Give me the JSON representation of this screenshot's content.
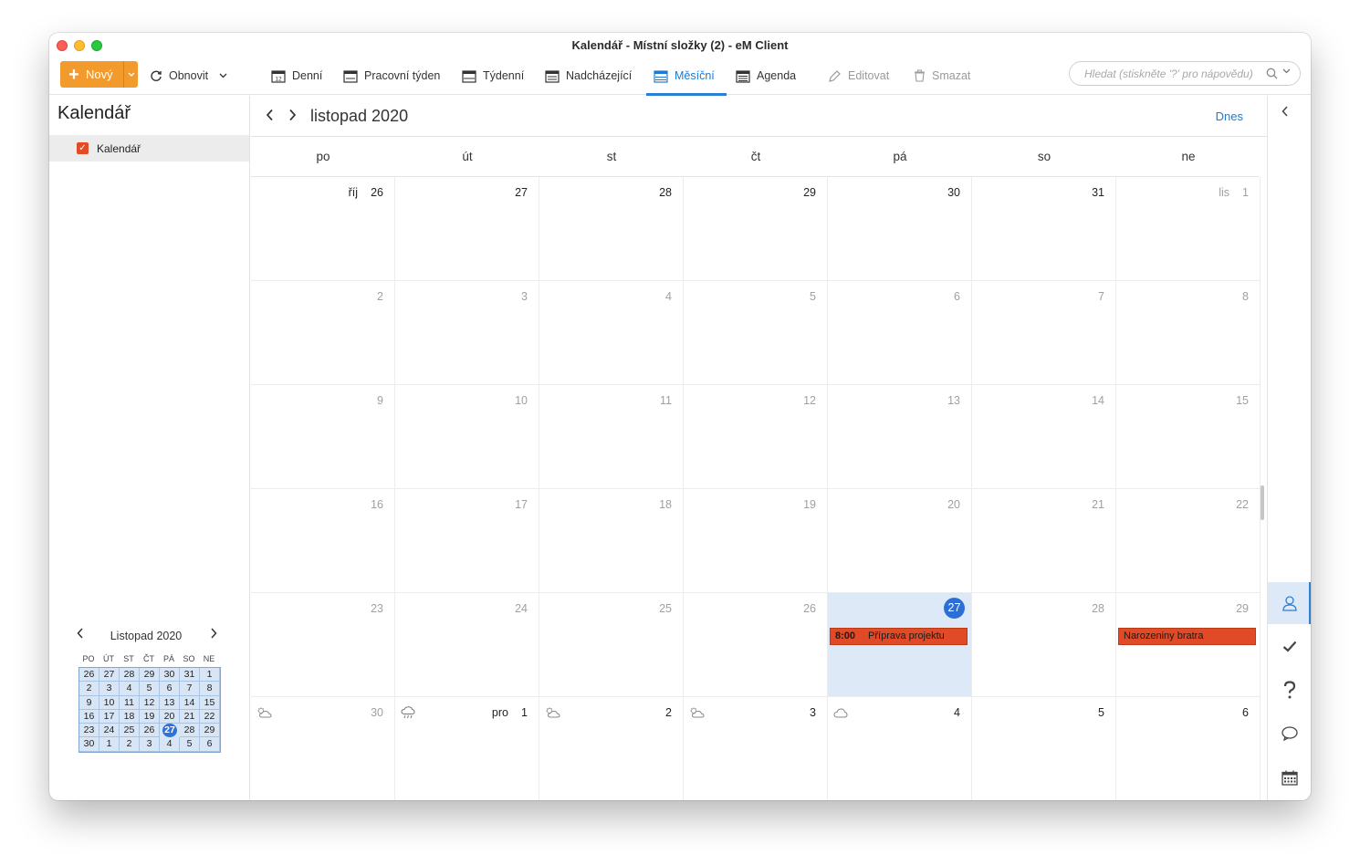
{
  "window": {
    "title": "Kalendář - Místní složky (2) - eM Client"
  },
  "toolbar": {
    "new_label": "Nový",
    "refresh_label": "Obnovit",
    "views": [
      {
        "label": "Denní",
        "icon": "calendar-day-icon"
      },
      {
        "label": "Pracovní týden",
        "icon": "calendar-workweek-icon"
      },
      {
        "label": "Týdenní",
        "icon": "calendar-week-icon"
      },
      {
        "label": "Nadcházející",
        "icon": "calendar-upcoming-icon"
      },
      {
        "label": "Měsíční",
        "icon": "calendar-month-icon",
        "active": true
      },
      {
        "label": "Agenda",
        "icon": "agenda-icon"
      }
    ],
    "edit_label": "Editovat",
    "delete_label": "Smazat",
    "search_placeholder": "Hledat (stiskněte '?' pro nápovědu)"
  },
  "sidebar": {
    "title": "Kalendář",
    "calendars": [
      {
        "label": "Kalendář",
        "color": "#e24b26",
        "checked": true
      }
    ],
    "mini_calendar": {
      "title": "Listopad 2020",
      "weekdays": [
        "PO",
        "ÚT",
        "ST",
        "ČT",
        "PÁ",
        "SO",
        "NE"
      ],
      "days": [
        "26",
        "27",
        "28",
        "29",
        "30",
        "31",
        "1",
        "2",
        "3",
        "4",
        "5",
        "6",
        "7",
        "8",
        "9",
        "10",
        "11",
        "12",
        "13",
        "14",
        "15",
        "16",
        "17",
        "18",
        "19",
        "20",
        "21",
        "22",
        "23",
        "24",
        "25",
        "26",
        "27",
        "28",
        "29",
        "30",
        "1",
        "2",
        "3",
        "4",
        "5",
        "6"
      ],
      "today": "27"
    },
    "bottom_nav": [
      "mail-icon",
      "calendar-icon",
      "tasks-icon",
      "more-icon"
    ]
  },
  "main": {
    "month_title": "listopad 2020",
    "today_label": "Dnes",
    "weekdays": [
      "po",
      "út",
      "st",
      "čt",
      "pá",
      "so",
      "ne"
    ],
    "month_labels": {
      "oct": "říj",
      "nov": "lis",
      "dec": "pro"
    },
    "weeks": [
      [
        {
          "d": "26",
          "m": "říj",
          "muted": false
        },
        {
          "d": "27"
        },
        {
          "d": "28"
        },
        {
          "d": "29"
        },
        {
          "d": "30"
        },
        {
          "d": "31"
        },
        {
          "d": "1",
          "m": "lis",
          "muted": true
        }
      ],
      [
        {
          "d": "2",
          "muted": true
        },
        {
          "d": "3",
          "muted": true
        },
        {
          "d": "4",
          "muted": true
        },
        {
          "d": "5",
          "muted": true
        },
        {
          "d": "6",
          "muted": true
        },
        {
          "d": "7",
          "muted": true
        },
        {
          "d": "8",
          "muted": true
        }
      ],
      [
        {
          "d": "9",
          "muted": true
        },
        {
          "d": "10",
          "muted": true
        },
        {
          "d": "11",
          "muted": true
        },
        {
          "d": "12",
          "muted": true
        },
        {
          "d": "13",
          "muted": true
        },
        {
          "d": "14",
          "muted": true
        },
        {
          "d": "15",
          "muted": true
        }
      ],
      [
        {
          "d": "16",
          "muted": true
        },
        {
          "d": "17",
          "muted": true
        },
        {
          "d": "18",
          "muted": true
        },
        {
          "d": "19",
          "muted": true
        },
        {
          "d": "20",
          "muted": true
        },
        {
          "d": "21",
          "muted": true
        },
        {
          "d": "22",
          "muted": true
        }
      ],
      [
        {
          "d": "23",
          "muted": true
        },
        {
          "d": "24",
          "muted": true
        },
        {
          "d": "25",
          "muted": true
        },
        {
          "d": "26",
          "muted": true
        },
        {
          "d": "27",
          "today": true
        },
        {
          "d": "28",
          "muted": true
        },
        {
          "d": "29",
          "muted": true
        }
      ],
      [
        {
          "d": "30",
          "muted": true,
          "wx": "partly-cloudy-icon"
        },
        {
          "d": "1",
          "m": "pro",
          "wx": "rain-icon"
        },
        {
          "d": "2",
          "wx": "partly-cloudy-icon"
        },
        {
          "d": "3",
          "wx": "partly-cloudy-icon"
        },
        {
          "d": "4",
          "wx": "cloud-icon"
        },
        {
          "d": "5"
        },
        {
          "d": "6"
        }
      ]
    ],
    "events": [
      {
        "week": 4,
        "day": 4,
        "time": "8:00",
        "title": "Příprava projektu",
        "color": "#e14a26"
      },
      {
        "week": 4,
        "day": 6,
        "time": "",
        "title": "Narozeniny bratra",
        "color": "#e14a26"
      }
    ]
  },
  "right_bar": [
    "collapse-icon",
    "contacts-icon",
    "tasks-check-icon",
    "help-icon",
    "chat-icon",
    "calendar-small-icon"
  ],
  "colors": {
    "accent": "#2b7fd4",
    "new_button": "#f39a2d",
    "today_bg": "#dde9f7",
    "event": "#e14a26"
  }
}
